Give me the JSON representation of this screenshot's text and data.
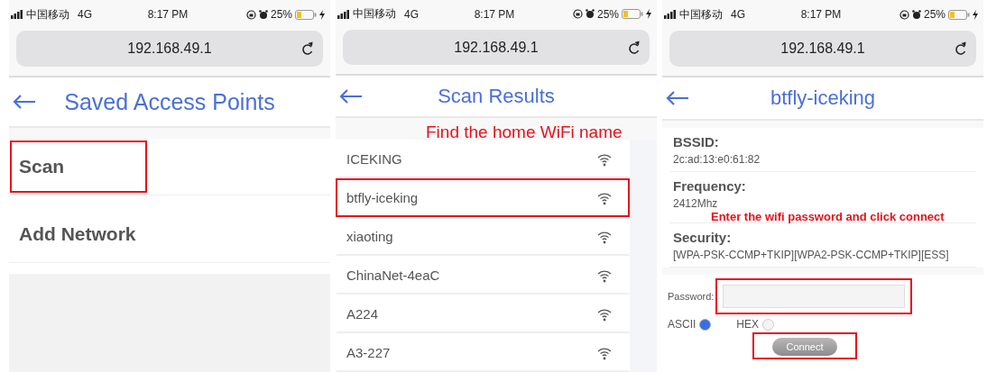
{
  "panels": [
    {
      "kind": "menu",
      "status_bar": {
        "carrier": "中国移动",
        "network": "4G",
        "time": "8:17 PM",
        "battery": "25%"
      },
      "url": "192.168.49.1",
      "title": "Saved Access Points",
      "items": [
        {
          "label": "Scan",
          "highlighted": true
        },
        {
          "label": "Add Network",
          "highlighted": false
        }
      ]
    },
    {
      "kind": "list",
      "status_bar": {
        "carrier": "中国移动",
        "network": "4G",
        "time": "8:17 PM",
        "battery": "25%"
      },
      "url": "192.168.49.1",
      "title": "Scan Results",
      "annotation": "Find the home WiFi name",
      "networks": [
        {
          "name": "ICEKING",
          "highlighted": false
        },
        {
          "name": "btfly-iceking",
          "highlighted": true
        },
        {
          "name": "xiaoting",
          "highlighted": false
        },
        {
          "name": "ChinaNet-4eaC",
          "highlighted": false
        },
        {
          "name": "A224",
          "highlighted": false
        },
        {
          "name": "A3-227",
          "highlighted": false
        }
      ]
    },
    {
      "kind": "detail",
      "status_bar": {
        "carrier": "中国移动",
        "network": "4G",
        "time": "8:17 PM",
        "battery": "25%"
      },
      "url": "192.168.49.1",
      "title": "btfly-iceking",
      "annotation": "Enter the wifi password and click connect",
      "fields": [
        {
          "label": "BSSID:",
          "value": "2c:ad:13:e0:61:82"
        },
        {
          "label": "Frequency:",
          "value": "2412Mhz"
        },
        {
          "label": "Security:",
          "value": "[WPA-PSK-CCMP+TKIP][WPA2-PSK-CCMP+TKIP][ESS]"
        }
      ],
      "password": {
        "label": "Password:",
        "highlighted": true
      },
      "encodings": [
        {
          "label": "ASCII",
          "selected": true
        },
        {
          "label": "HEX",
          "selected": false
        }
      ],
      "connect": {
        "label": "Connect",
        "disabled": true,
        "highlighted": true
      }
    }
  ]
}
